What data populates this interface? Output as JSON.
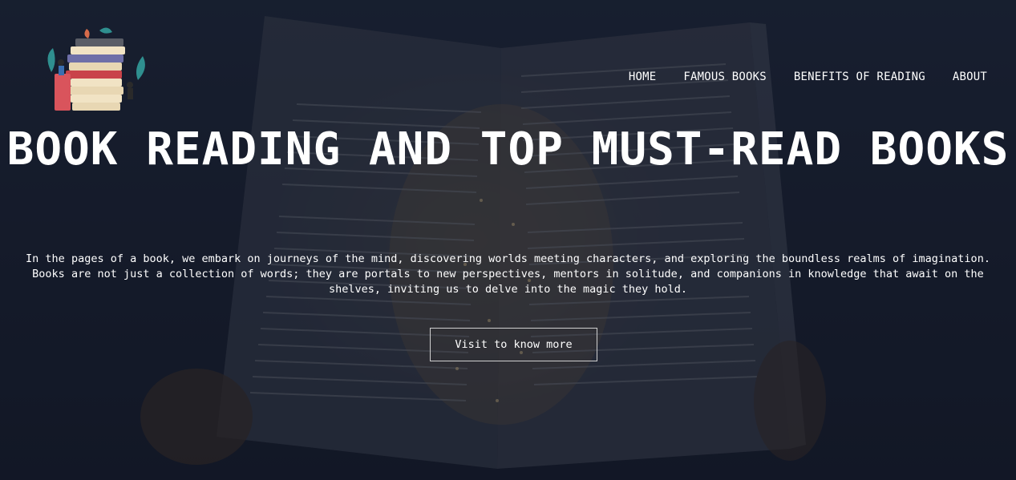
{
  "nav": {
    "items": [
      "HOME",
      "FAMOUS BOOKS",
      "BENEFITS OF READING",
      "ABOUT"
    ]
  },
  "hero": {
    "title": "BOOK READING AND TOP MUST-READ BOOKS",
    "description": "In the pages of a book, we embark on journeys of the mind, discovering worlds meeting characters, and exploring the boundless realms of imagination. Books are not just a collection of words; they are portals to new perspectives, mentors in solitude, and companions in knowledge that await on the shelves, inviting us to delve into the magic they hold.",
    "cta_label": "Visit to know more"
  },
  "icons": {
    "logo": "book-stack-icon"
  },
  "colors": {
    "text": "#ffffff",
    "background": "#1b2233",
    "button_border": "#d0d0d0"
  }
}
